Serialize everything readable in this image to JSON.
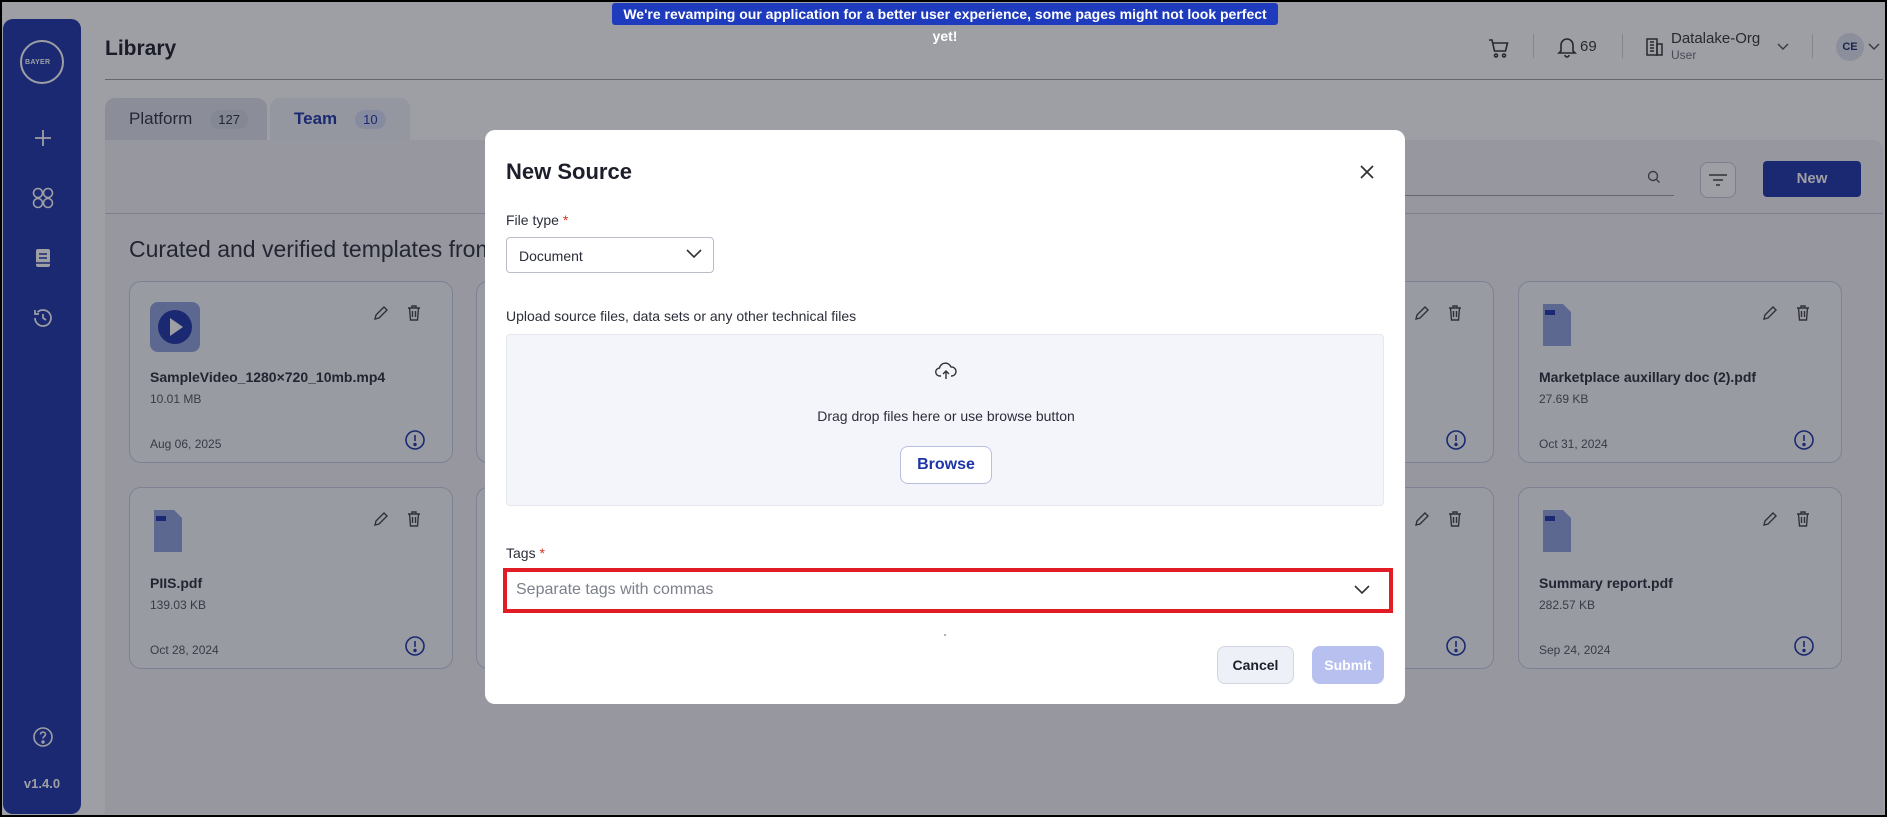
{
  "banner": "We're revamping our application for a better user experience, some pages might not look perfect yet!",
  "brand": {
    "logo_text": "BAYER",
    "version": "v1.4.0"
  },
  "sidebar": {
    "items": [
      {
        "icon": "plus-icon",
        "label": ""
      },
      {
        "icon": "grid-icon",
        "label": ""
      },
      {
        "icon": "book-icon",
        "label": ""
      },
      {
        "icon": "history-icon",
        "label": ""
      },
      {
        "icon": "help-icon",
        "label": ""
      }
    ]
  },
  "header": {
    "title": "Library",
    "notification_count": "69",
    "org_name": "Datalake-Org",
    "org_role": "User",
    "avatar_initials": "CE"
  },
  "tabs": [
    {
      "label": "Platform",
      "count": "127",
      "active": false
    },
    {
      "label": "Team",
      "count": "10",
      "active": true
    }
  ],
  "toolbar": {
    "new_label": "New"
  },
  "section_title": "Curated and verified templates from",
  "cards": [
    {
      "name": "SampleVideo_1280×720_10mb.mp4",
      "size": "10.01 MB",
      "date": "Aug 06, 2025",
      "type": "video"
    },
    {
      "name": "Marketplace auxillary doc (2).pdf",
      "size": "27.69 KB",
      "date": "Oct 31, 2024",
      "type": "pdf"
    },
    {
      "name": "PIIS.pdf",
      "size": "139.03 KB",
      "date": "Oct 28, 2024",
      "type": "pdf"
    },
    {
      "name": "Summary report.pdf",
      "size": "282.57 KB",
      "date": "Sep 24, 2024",
      "type": "pdf"
    }
  ],
  "modal": {
    "title": "New Source",
    "file_type_label": "File type",
    "file_type_value": "Document",
    "upload_label": "Upload source files, data sets or any other technical files",
    "dropzone_text": "Drag drop files here or use browse button",
    "browse_label": "Browse",
    "tags_label": "Tags",
    "tags_placeholder": "Separate tags with commas",
    "required_marker": "*",
    "cancel_label": "Cancel",
    "submit_label": "Submit"
  },
  "colors": {
    "brand": "#1d35a8",
    "highlight": "#e21c24",
    "required": "#d9341f"
  }
}
